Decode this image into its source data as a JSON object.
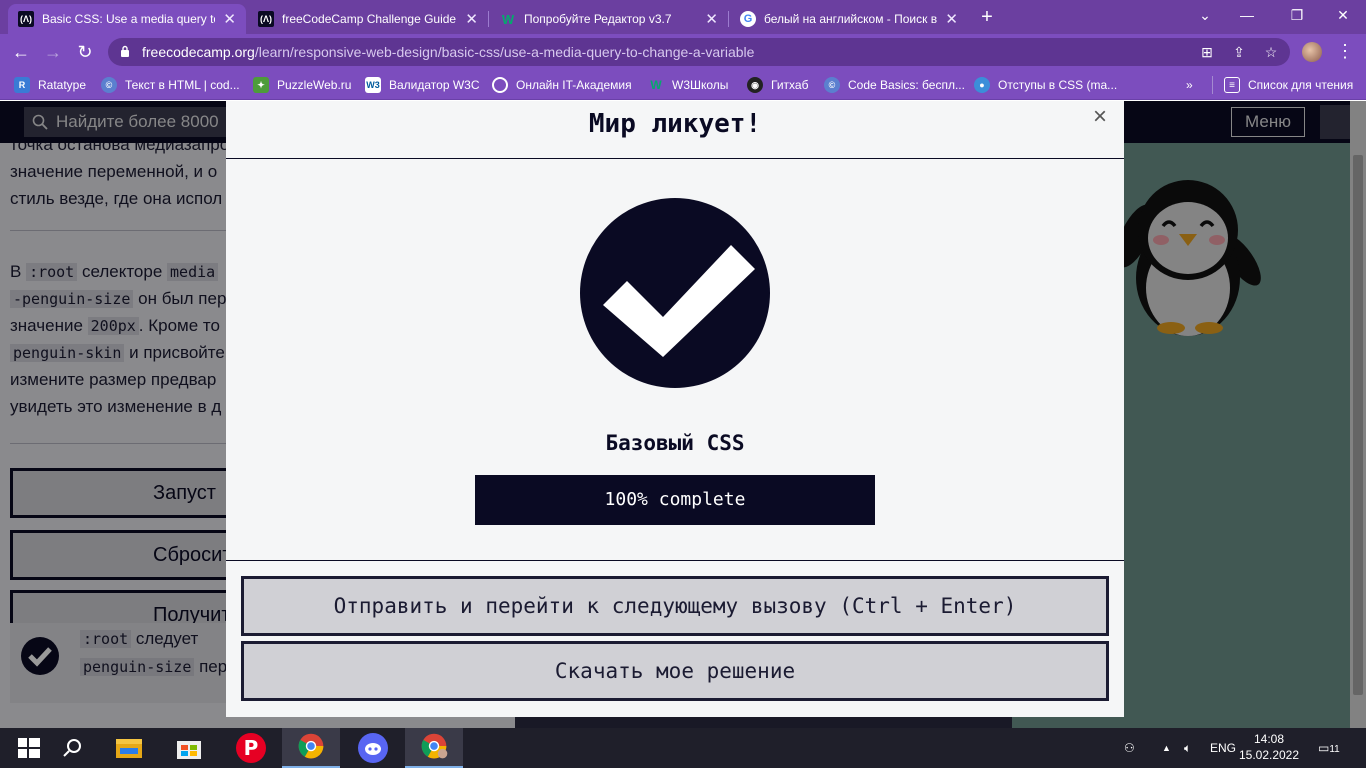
{
  "browser": {
    "tabs": [
      {
        "title": "Basic CSS: Use a media query to c",
        "favicon": "fcc-icon",
        "active": true
      },
      {
        "title": "freeCodeCamp Challenge Guide:",
        "favicon": "fcc-icon",
        "active": false
      },
      {
        "title": "Попробуйте Редактор v3.7",
        "favicon": "w3-icon",
        "active": false
      },
      {
        "title": "белый на английском - Поиск в",
        "favicon": "google-icon",
        "active": false
      }
    ],
    "url_host": "freecodecamp.org",
    "url_path": "/learn/responsive-web-design/basic-css/use-a-media-query-to-change-a-variable",
    "bookmarks": [
      "Ratatype",
      "Текст в HTML | cod...",
      "PuzzleWeb.ru",
      "Валидатор W3C",
      "Онлайн IT-Академия",
      "W3Школы",
      "Гитхаб",
      "Code Basics: беспл...",
      "Отступы в CSS (ma..."
    ],
    "reading_list": "Список для чтения"
  },
  "fcc": {
    "search_placeholder": "Найдите более 8000",
    "menu_label": "Меню",
    "lesson_lines_top": [
      "точка останова медиазапроса",
      "значение переменной, и о",
      "стиль везде, где она испол"
    ],
    "para": {
      "l1_a": "В ",
      "l1_code1": ":root",
      "l1_b": " селекторе ",
      "l1_code2": "media",
      "l2_code": "-penguin-size",
      "l2_b": " он был пер",
      "l3_a": "значение ",
      "l3_code": "200px",
      "l3_b": ". Кроме то",
      "l4_code": "penguin-skin",
      "l4_b": " и присвойте",
      "l5": "измените размер предвар",
      "l6": "увидеть это изменение в д"
    },
    "buttons": [
      "Запуст",
      "Сбросит",
      "Получит"
    ],
    "test": {
      "code1": ":root",
      "t1": " следует",
      "code2": "penguin-size",
      "t2": " пер"
    }
  },
  "modal": {
    "title": "Мир ликует!",
    "close": "×",
    "cert_name": "Базовый CSS",
    "progress_label": "100% complete",
    "progress_value": 1.0,
    "submit_button": "Отправить и перейти к следующему вызову (Ctrl + Enter)",
    "download_button": "Скачать мое решение"
  },
  "taskbar": {
    "language": "ENG",
    "time": "14:08",
    "date": "15.02.2022",
    "notifications": "11"
  },
  "colors": {
    "fcc_dark": "#0a0a23",
    "browser_purple": "#7c4dbe",
    "modal_bg": "#f5f6f7",
    "button_bg": "#d0d0d5",
    "preview_bg": "#6d938b"
  }
}
